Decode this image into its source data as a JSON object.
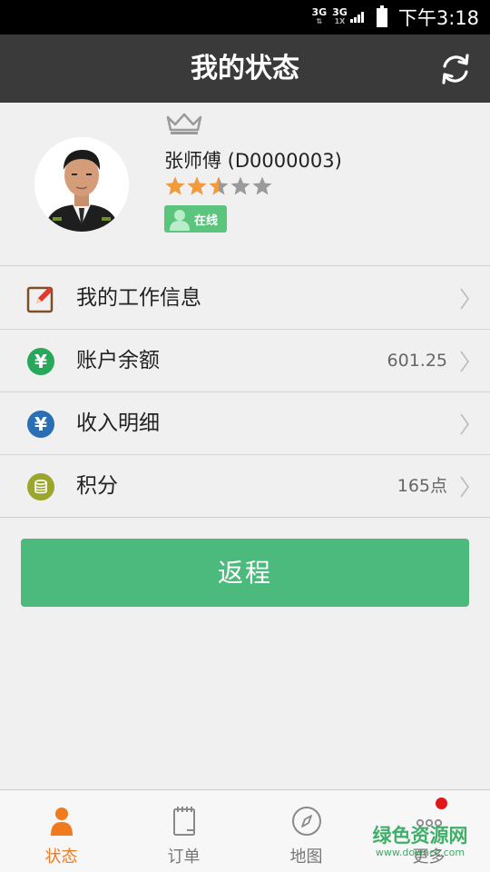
{
  "status_bar": {
    "net1": "3G",
    "net2": "3G",
    "net2_sub": "1X",
    "time": "下午3:18"
  },
  "header": {
    "title": "我的状态",
    "refresh_icon": "refresh-icon"
  },
  "profile": {
    "avatar_icon": "driver-avatar",
    "crown_icon": "crown-icon",
    "name": "张师傅 (D0000003)",
    "rating": 2.5,
    "rating_max": 5,
    "status": "在线",
    "colors": {
      "star_filled": "#f39a3c",
      "star_empty": "#9a9a9a",
      "online_bg": "#5bc47d"
    }
  },
  "menu": {
    "items": [
      {
        "label": "我的工作信息",
        "value": "",
        "icon": "edit-icon"
      },
      {
        "label": "账户余额",
        "value": "601.25",
        "icon": "yuan-icon"
      },
      {
        "label": "收入明细",
        "value": "",
        "icon": "yuan-icon"
      },
      {
        "label": "积分",
        "value": "165点",
        "icon": "coins-icon"
      }
    ]
  },
  "return_button": {
    "label": "返程",
    "color": "#4cba7c"
  },
  "tabbar": {
    "tabs": [
      {
        "label": "状态",
        "icon": "person-icon",
        "active": true
      },
      {
        "label": "订单",
        "icon": "notebook-icon",
        "active": false
      },
      {
        "label": "地图",
        "icon": "compass-icon",
        "active": false
      },
      {
        "label": "更多",
        "icon": "more-icon",
        "active": false
      }
    ],
    "accent": "#f07a1e"
  },
  "watermark": {
    "line1": "绿色资源网",
    "line2": "www.downcc.com"
  }
}
